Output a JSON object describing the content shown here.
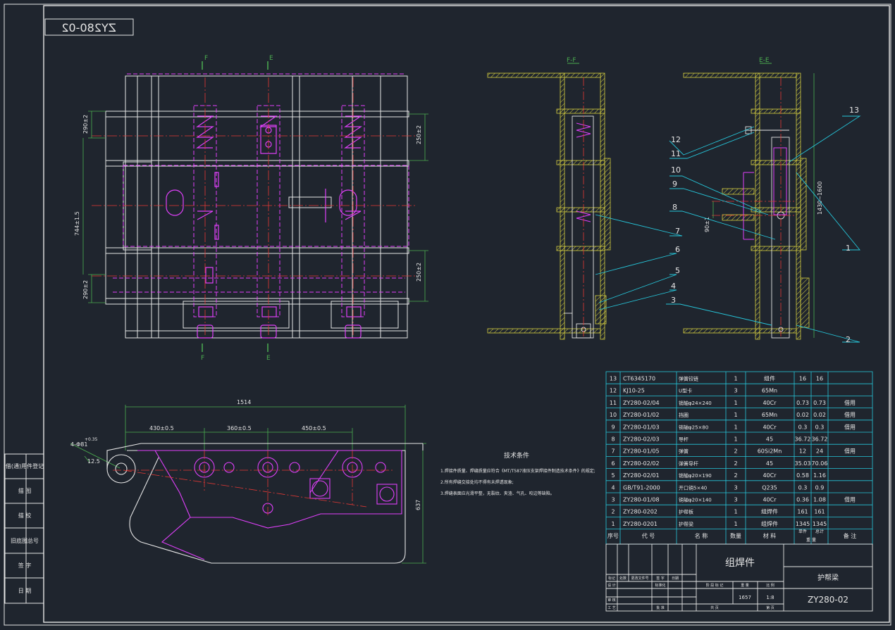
{
  "drawing_code_mirrored": "ZY280-02",
  "section_labels": {
    "f_top": "F",
    "e_top": "E",
    "f_bottom": "F",
    "e_bottom": "E",
    "ff_view": "F-F",
    "ee_view": "E-E"
  },
  "dimensions": {
    "d290_top": "290±2",
    "d744": "744±1.5",
    "d290_bottom": "290±2",
    "d250_top": "250±2",
    "d250_bottom": "250±2",
    "d1514": "1514",
    "d430": "430±0.5",
    "d360": "360±0.5",
    "d450": "450±0.5",
    "d637": "637",
    "hole_note": "4-Φ81",
    "hole_tol": "+0.35",
    "d12_5": "12.5",
    "d1430": "1430~1600",
    "d90": "90±1"
  },
  "leaders": [
    "13",
    "12",
    "11",
    "10",
    "9",
    "8",
    "7",
    "6",
    "5",
    "4",
    "3",
    "2",
    "1"
  ],
  "tech": {
    "title": "技术条件",
    "lines": [
      "1.焊接件质量、焊缝质量应符合《MT/T587液压支架焊接件制造技术条件》的规定;",
      "2.所有焊缝交接处均不得有未焊透现象;",
      "3.焊缝表面应光滑平整，无裂纹、夹渣、气孔、咬边等缺陷。"
    ]
  },
  "bom": {
    "rows": [
      {
        "no": "13",
        "code": "CT6345170",
        "name": "弹簧铰链",
        "qty": "1",
        "mat": "组件",
        "w1": "16",
        "w2": "16",
        "note": ""
      },
      {
        "no": "12",
        "code": "KJ10-25",
        "name": "U型卡",
        "qty": "3",
        "mat": "65Mn",
        "w1": "",
        "w2": "",
        "note": ""
      },
      {
        "no": "11",
        "code": "ZY280-02/04",
        "name": "销轴φ24×240",
        "qty": "1",
        "mat": "40Cr",
        "w1": "0.73",
        "w2": "0.73",
        "note": "借用"
      },
      {
        "no": "10",
        "code": "ZY280-01/02",
        "name": "挡圈",
        "qty": "1",
        "mat": "65Mn",
        "w1": "0.02",
        "w2": "0.02",
        "note": "借用"
      },
      {
        "no": "9",
        "code": "ZY280-01/03",
        "name": "销轴φ25×80",
        "qty": "1",
        "mat": "40Cr",
        "w1": "0.3",
        "w2": "0.3",
        "note": "借用"
      },
      {
        "no": "8",
        "code": "ZY280-02/03",
        "name": "导杆",
        "qty": "1",
        "mat": "45",
        "w1": "36.72",
        "w2": "36.72",
        "note": ""
      },
      {
        "no": "7",
        "code": "ZY280-01/05",
        "name": "弹簧",
        "qty": "2",
        "mat": "60Si2Mn",
        "w1": "12",
        "w2": "24",
        "note": "借用"
      },
      {
        "no": "6",
        "code": "ZY280-02/02",
        "name": "弹簧导杆",
        "qty": "2",
        "mat": "45",
        "w1": "35.03",
        "w2": "70.06",
        "note": ""
      },
      {
        "no": "5",
        "code": "ZY280-02/01",
        "name": "销轴φ20×190",
        "qty": "2",
        "mat": "40Cr",
        "w1": "0.58",
        "w2": "1.16",
        "note": ""
      },
      {
        "no": "4",
        "code": "GB/T91-2000",
        "name": "开口销5×40",
        "qty": "3",
        "mat": "Q235",
        "w1": "0.3",
        "w2": "0.9",
        "note": ""
      },
      {
        "no": "3",
        "code": "ZY280-01/08",
        "name": "销轴φ20×140",
        "qty": "3",
        "mat": "40Cr",
        "w1": "0.36",
        "w2": "1.08",
        "note": "借用"
      },
      {
        "no": "2",
        "code": "ZY280-0202",
        "name": "护帮板",
        "qty": "1",
        "mat": "组焊件",
        "w1": "161",
        "w2": "161",
        "note": ""
      },
      {
        "no": "1",
        "code": "ZY280-0201",
        "name": "护帮梁",
        "qty": "1",
        "mat": "组焊件",
        "w1": "1345",
        "w2": "1345",
        "note": ""
      }
    ],
    "header": {
      "no": "序号",
      "code": "代 号",
      "name": "名 称",
      "qty": "数量",
      "mat": "材 料",
      "w_single": "单件",
      "w_total": "总计",
      "w_label": "重 量",
      "note": "备 注"
    }
  },
  "title_block": {
    "weldment": "组焊件",
    "part_name": "护帮梁",
    "code": "ZY280-02",
    "weight": "1657",
    "scale": "1:8",
    "h_labels": [
      "标记",
      "处数",
      "更改文件号",
      "签 字",
      "日期"
    ],
    "designer": "设 计",
    "standard": "标准化",
    "checker": "审 核",
    "process": "工 艺",
    "approve": "批 准",
    "stage": "阶 段 标 记",
    "weight_label": "重 量",
    "scale_label": "比 例",
    "sheets": "共 页",
    "sheet": "第 页"
  },
  "left_strip": [
    "借(通)用件登记",
    "描 图",
    "描 校",
    "旧底图总号",
    "签 字",
    "日 期"
  ]
}
